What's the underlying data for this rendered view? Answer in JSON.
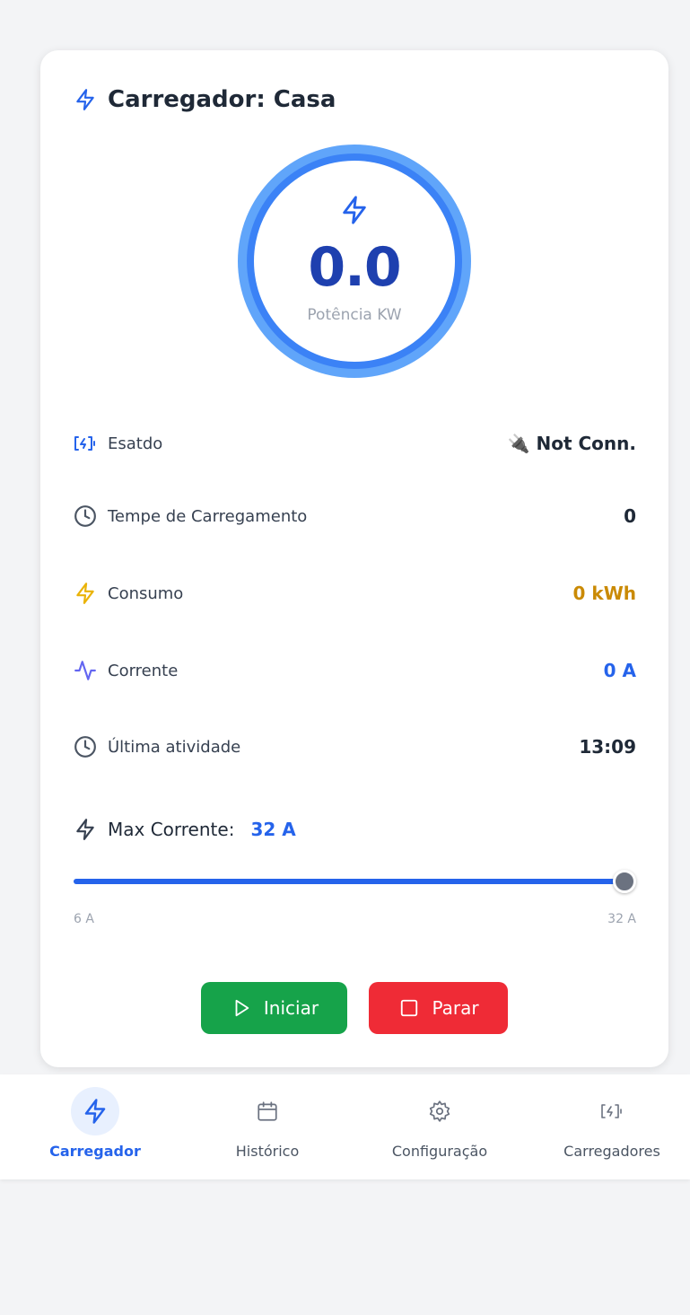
{
  "card": {
    "title": "Carregador: Casa"
  },
  "gauge": {
    "value": "0.0",
    "label": "Potência KW"
  },
  "rows": [
    {
      "icon": "charging-station-icon",
      "label": "Esatdo",
      "value_icon": "plug-emoji-icon",
      "value": "🔌 Not Conn."
    },
    {
      "icon": "clock-icon",
      "label": "Tempe de Carregamento",
      "value": "0"
    },
    {
      "icon": "lightning-bolt-icon",
      "label": "Consumo",
      "value": "0 kWh"
    },
    {
      "icon": "activity-pulse-icon",
      "label": "Corrente",
      "value": "0 A"
    },
    {
      "icon": "clock-icon",
      "label": "Última atividade",
      "value": "13:09"
    }
  ],
  "max_current": {
    "label": "Max Corrente:",
    "value": "32 A",
    "min_label": "6 A",
    "max_label": "32 A",
    "min": 6,
    "max": 32,
    "current": 32
  },
  "buttons": {
    "start": "Iniciar",
    "stop": "Parar"
  },
  "nav": {
    "items": [
      {
        "label": "Carregador",
        "icon": "lightning-bolt-icon",
        "active": true
      },
      {
        "label": "Histórico",
        "icon": "calendar-icon",
        "active": false
      },
      {
        "label": "Configuração",
        "icon": "gear-icon",
        "active": false
      },
      {
        "label": "Carregadores",
        "icon": "charging-station-icon",
        "active": false
      }
    ]
  },
  "colors": {
    "primary": "#2563eb",
    "amber": "#ca8a04",
    "success": "#16a34a",
    "danger": "#ef2b36",
    "purple": "#6366f1"
  }
}
